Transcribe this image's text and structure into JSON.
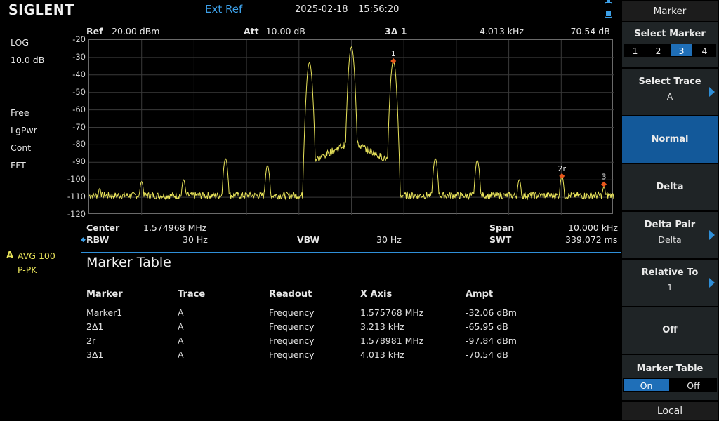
{
  "topbar": {
    "brand": "SIGLENT",
    "ext_ref": "Ext Ref",
    "date": "2025-02-18",
    "time": "15:56:20",
    "battery_icon": "battery-icon"
  },
  "left_status": {
    "scale_type": "LOG",
    "scale_div": "10.0 dB",
    "sweep_mode": "Free",
    "detector_avg": "LgPwr",
    "trigger": "Cont",
    "sweep_type": "FFT",
    "trace_label": "A",
    "trace_avg": "AVG 100",
    "trace_detector": "P-PK"
  },
  "header": {
    "ref_label": "Ref",
    "ref_value": "-20.00 dBm",
    "att_label": "Att",
    "att_value": "10.00 dB",
    "marker_id": "3Δ 1",
    "marker_x": "4.013 kHz",
    "marker_y": "-70.54 dB"
  },
  "params": {
    "center_label": "Center",
    "center_value": "1.574968 MHz",
    "span_label": "Span",
    "span_value": "10.000 kHz",
    "rbw_label": "RBW",
    "rbw_value": "30 Hz",
    "vbw_label": "VBW",
    "vbw_value": "30 Hz",
    "swt_label": "SWT",
    "swt_value": "339.072 ms"
  },
  "chart_data": {
    "type": "line",
    "ylim": [
      -120,
      -20
    ],
    "yticks": [
      "-20",
      "-30",
      "-40",
      "-50",
      "-60",
      "-70",
      "-80",
      "-90",
      "-100",
      "-110",
      "-120"
    ],
    "x_range_mhz": [
      1.569968,
      1.579968
    ],
    "grid": true,
    "trace_color": "#e8e35a",
    "noise_floor_dbm": -109,
    "peaks_x_mhz": [
      1.570168,
      1.570968,
      1.571768,
      1.572568,
      1.573368,
      1.574168,
      1.574968,
      1.575768,
      1.576568,
      1.577368,
      1.578168,
      1.578981,
      1.579781
    ],
    "peaks_y_dbm": [
      -105,
      -101,
      -100,
      -88,
      -92,
      -33,
      -24,
      -32,
      -88,
      -89,
      -100,
      -98,
      -104
    ],
    "markers": [
      {
        "label": "1",
        "x_mhz": 1.575768,
        "y_dbm": -32.06
      },
      {
        "label": "2r",
        "x_mhz": 1.578981,
        "y_dbm": -97.84
      },
      {
        "label": "3",
        "x_mhz": 1.579781,
        "y_dbm": -102.6
      }
    ],
    "marker_color": "#e8581c"
  },
  "marker_table": {
    "title": "Marker Table",
    "headers": [
      "Marker",
      "Trace",
      "Readout",
      "X Axis",
      "Ampt"
    ],
    "rows": [
      [
        "Marker1",
        "A",
        "Frequency",
        "1.575768 MHz",
        "-32.06 dBm"
      ],
      [
        "2Δ1",
        "A",
        "Frequency",
        "3.213 kHz",
        "-65.95 dB"
      ],
      [
        "2r",
        "A",
        "Frequency",
        "1.578981 MHz",
        "-97.84 dBm"
      ],
      [
        "3Δ1",
        "A",
        "Frequency",
        "4.013 kHz",
        "-70.54 dB"
      ]
    ]
  },
  "menu": {
    "title": "Marker",
    "select_marker": "Select Marker",
    "marker_options": [
      "1",
      "2",
      "3",
      "4"
    ],
    "selected_marker": "3",
    "select_trace": "Select Trace",
    "select_trace_value": "A",
    "normal": "Normal",
    "delta": "Delta",
    "delta_pair": "Delta Pair",
    "delta_pair_value": "Delta",
    "relative_to": "Relative To",
    "relative_to_value": "1",
    "off": "Off",
    "marker_table": "Marker Table",
    "marker_table_on": "On",
    "marker_table_off": "Off",
    "local": "Local"
  }
}
